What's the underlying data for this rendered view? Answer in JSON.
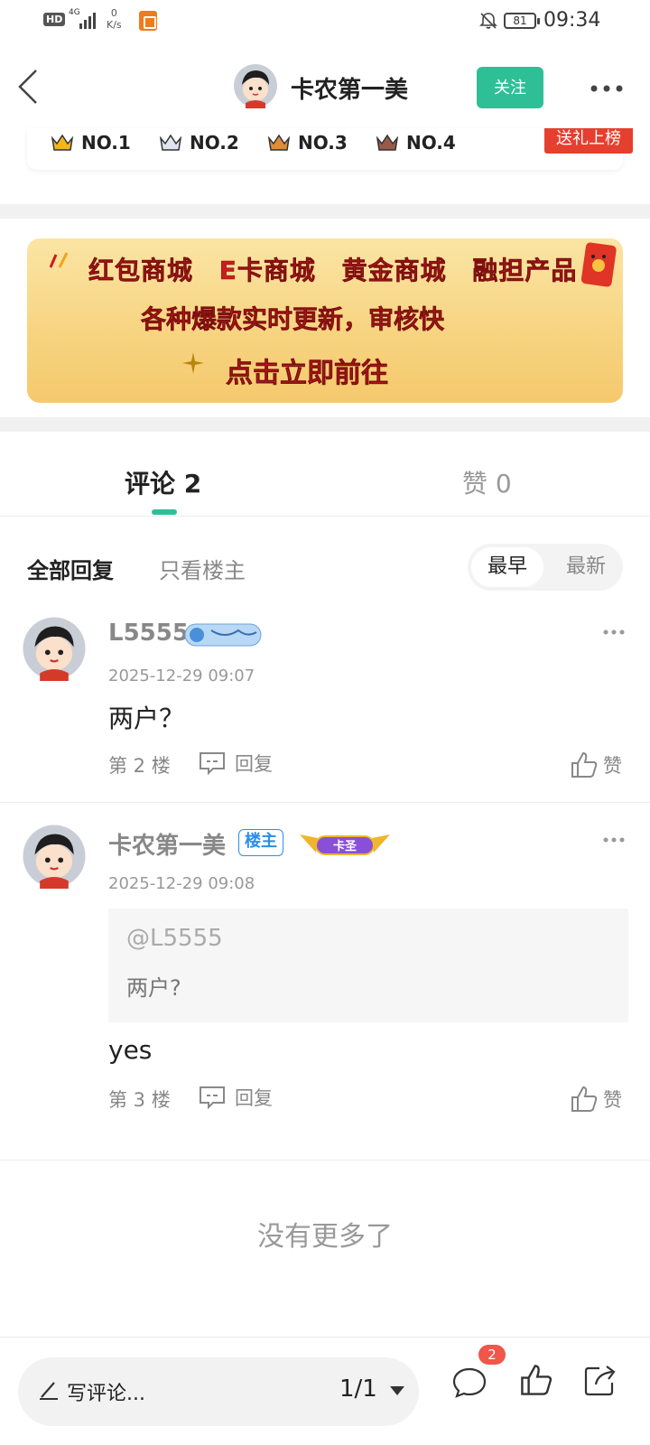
{
  "status_bar": {
    "hd": "HD",
    "network": "4G",
    "speed_value": "0",
    "speed_unit": "K/s",
    "battery": "81",
    "time": "09:34"
  },
  "nav": {
    "title": "卡农第一美",
    "follow_label": "关注"
  },
  "ranking": {
    "items": [
      {
        "label": "NO.1",
        "color": "#f2b51e"
      },
      {
        "label": "NO.2",
        "color": "#8a99b3"
      },
      {
        "label": "NO.3",
        "color": "#e08c3a"
      },
      {
        "label": "NO.4",
        "color": "#6b4a3a"
      }
    ],
    "gift_label": "送礼上榜"
  },
  "banner": {
    "row1": "红包商城 E卡商城 黄金商城 融担产品",
    "row2": "各种爆款实时更新，审核快",
    "row3": "点击立即前往"
  },
  "tabs": {
    "comments": "评论 2",
    "likes": "赞 0"
  },
  "filter": {
    "all": "全部回复",
    "owner_only": "只看楼主",
    "sort_early": "最早",
    "sort_late": "最新"
  },
  "comments": [
    {
      "user": "L5555",
      "time": "2025-12-29 09:07",
      "text": "两户？",
      "floor": "第 2 楼",
      "reply_label": "回复",
      "like_label": "赞"
    },
    {
      "user": "卡农第一美",
      "owner_badge": "楼主",
      "medal": "卡圣",
      "time": "2025-12-29 09:08",
      "quote_user": "@L5555",
      "quote_text": "两户?",
      "text": "yes",
      "floor": "第 3 楼",
      "reply_label": "回复",
      "like_label": "赞"
    }
  ],
  "no_more": "没有更多了",
  "bottom_bar": {
    "write_placeholder": "写评论...",
    "page": "1/1",
    "comment_count": "2"
  },
  "colors": {
    "accent": "#2fbf96",
    "gift_red": "#e53f2f",
    "banner_text": "#cc1c1c"
  }
}
